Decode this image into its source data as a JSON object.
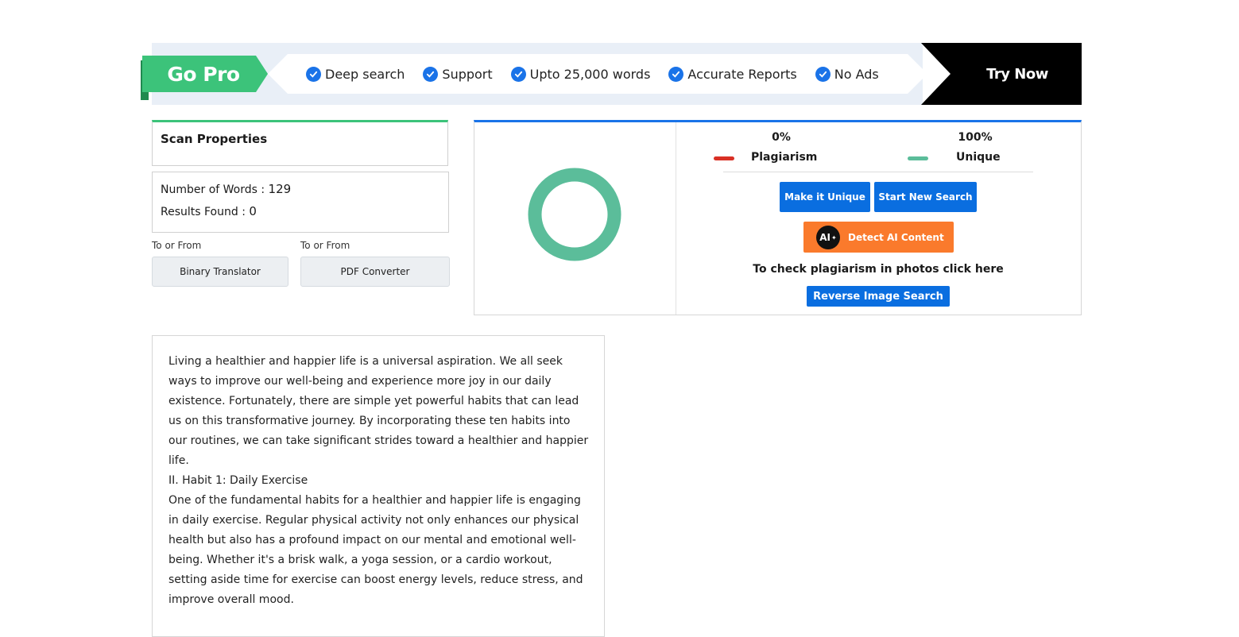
{
  "banner": {
    "gopro_label": "Go Pro",
    "features": [
      "Deep search",
      "Support",
      "Upto 25,000 words",
      "Accurate Reports",
      "No Ads"
    ],
    "try_now_label": "Try Now",
    "colors": {
      "gopro": "#3cc37a",
      "check": "#1a73e8",
      "try_now_bg": "#000000"
    },
    "icons": {
      "feature": "check-circle-icon"
    }
  },
  "scan_properties": {
    "title": "Scan Properties",
    "words_label": "Number of Words : ",
    "words_value": "129",
    "results_label": "Results Found : ",
    "results_value": "0"
  },
  "tools": [
    {
      "caption": "To or From",
      "label": "Binary Translator"
    },
    {
      "caption": "To or From",
      "label": "PDF Converter"
    }
  ],
  "results": {
    "plagiarism_pct": "0%",
    "plagiarism_label": "Plagiarism",
    "unique_pct": "100%",
    "unique_label": "Unique",
    "plagiarism_fraction": 0,
    "unique_fraction": 1,
    "colors": {
      "plagiarism": "#d93025",
      "unique": "#5bbd9a",
      "accent": "#1a73e8"
    },
    "make_unique_label": "Make it Unique",
    "new_search_label": "Start New Search",
    "detect_ai_label": "Detect AI Content",
    "ai_badge_text": "AI",
    "photo_text": "To check plagiarism in photos click here",
    "reverse_image_label": "Reverse Image Search"
  },
  "document": {
    "paragraphs": [
      "Living a healthier and happier life is a universal aspiration. We all seek ways to improve our well-being and experience more joy in our daily existence. Fortunately, there are simple yet powerful habits that can lead us on this transformative journey. By incorporating these ten habits into our routines, we can take significant strides toward a healthier and happier life.",
      "II. Habit 1: Daily Exercise",
      "One of the fundamental habits for a healthier and happier life is engaging in daily exercise. Regular physical activity not only enhances our physical health but also has a profound impact on our mental and emotional well-being. Whether it's a brisk walk, a yoga session, or a cardio workout, setting aside time for exercise can boost energy levels, reduce stress, and improve overall mood."
    ]
  }
}
